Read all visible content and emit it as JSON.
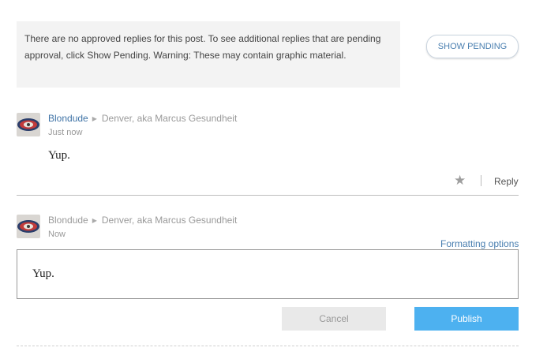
{
  "notice": {
    "text": "There are no approved replies for this post. To see additional replies that are pending approval, click Show Pending. Warning: These may contain graphic material."
  },
  "show_pending_label": "SHOW PENDING",
  "comment": {
    "author": "Blondude",
    "location": "Denver, aka Marcus Gesundheit",
    "time": "Just now",
    "body": "Yup.",
    "reply_label": "Reply"
  },
  "composer": {
    "author": "Blondude",
    "location": "Denver, aka Marcus Gesundheit",
    "time": "Now",
    "formatting_label": "Formatting options",
    "editor_text": "Yup.",
    "cancel_label": "Cancel",
    "publish_label": "Publish"
  },
  "icons": {
    "caret": "caret-right-icon",
    "star": "star-icon"
  },
  "colors": {
    "link": "#3f73a6",
    "publish_bg": "#4db1f0",
    "notice_bg": "#f3f3f3"
  }
}
